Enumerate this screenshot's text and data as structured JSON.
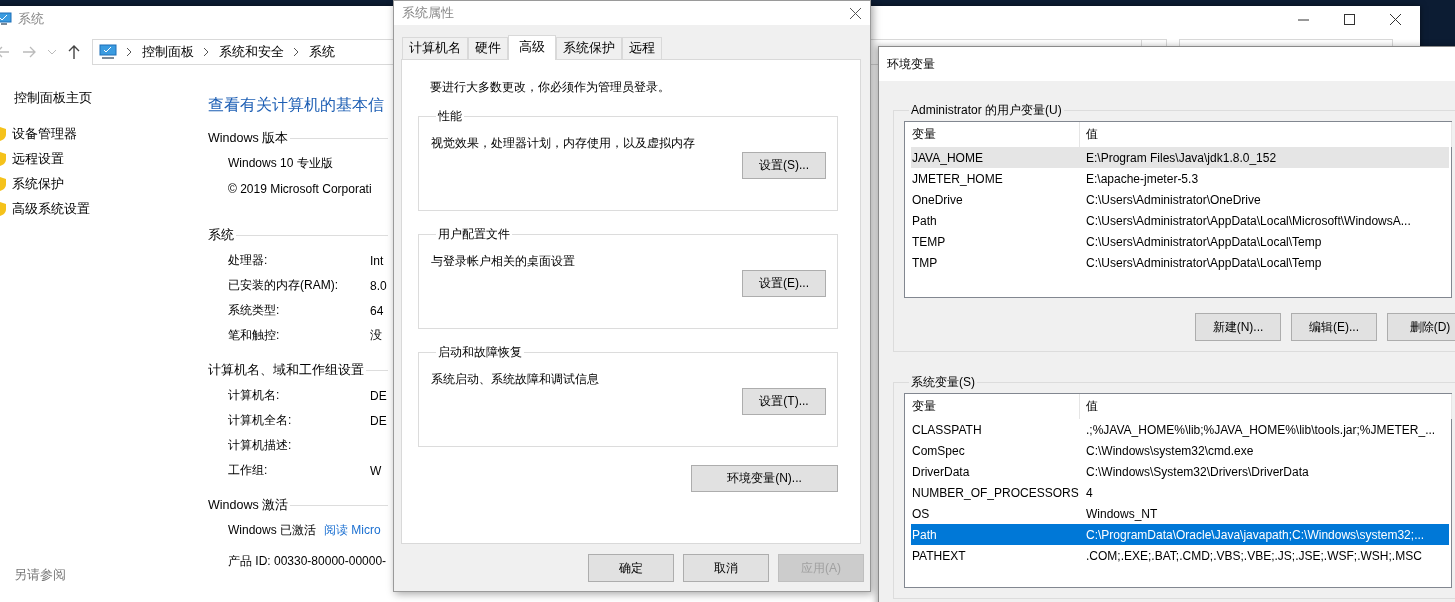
{
  "system_window": {
    "title": "系统",
    "breadcrumbs": [
      "控制面板",
      "系统和安全",
      "系统"
    ],
    "sidebar": {
      "home": "控制面板主页",
      "links": [
        "设备管理器",
        "远程设置",
        "系统保护",
        "高级系统设置"
      ],
      "see_also": "另请参阅"
    },
    "heading": "查看有关计算机的基本信",
    "sections": [
      {
        "title": "Windows 版本",
        "items": [
          {
            "kind": "text",
            "text": "Windows 10 专业版"
          },
          {
            "kind": "text",
            "text": "© 2019 Microsoft Corporati"
          }
        ]
      },
      {
        "title": "系统",
        "items": [
          {
            "kind": "field",
            "label": "处理器:",
            "value": "Int"
          },
          {
            "kind": "field",
            "label": "已安装的内存(RAM):",
            "value": "8.0"
          },
          {
            "kind": "field",
            "label": "系统类型:",
            "value": "64"
          },
          {
            "kind": "field",
            "label": "笔和触控:",
            "value": "没"
          }
        ]
      },
      {
        "title": "计算机名、域和工作组设置",
        "items": [
          {
            "kind": "field",
            "label": "计算机名:",
            "value": "DE"
          },
          {
            "kind": "field",
            "label": "计算机全名:",
            "value": "DE"
          },
          {
            "kind": "field",
            "label": "计算机描述:"
          },
          {
            "kind": "field",
            "label": "工作组:",
            "value": "W"
          }
        ]
      },
      {
        "title": "Windows 激活",
        "items": [
          {
            "kind": "status",
            "text": "Windows 已激活",
            "link": "阅读 Micro"
          },
          {
            "kind": "text",
            "text": "产品 ID: 00330-80000-00000-"
          }
        ]
      }
    ]
  },
  "properties_dialog": {
    "title": "系统属性",
    "tabs": [
      {
        "label": "计算机名",
        "selected": false
      },
      {
        "label": "硬件",
        "selected": false
      },
      {
        "label": "高级",
        "selected": true
      },
      {
        "label": "系统保护",
        "selected": false
      },
      {
        "label": "远程",
        "selected": false
      }
    ],
    "notice": "要进行大多数更改，你必须作为管理员登录。",
    "groups": [
      {
        "title": "性能",
        "description": "视觉效果，处理器计划，内存使用，以及虚拟内存",
        "button": "设置(S)..."
      },
      {
        "title": "用户配置文件",
        "description": "与登录帐户相关的桌面设置",
        "button": "设置(E)..."
      },
      {
        "title": "启动和故障恢复",
        "description": "系统启动、系统故障和调试信息",
        "button": "设置(T)..."
      }
    ],
    "env_button": "环境变量(N)...",
    "buttons": [
      {
        "label": "确定",
        "disabled": false
      },
      {
        "label": "取消",
        "disabled": false
      },
      {
        "label": "应用(A)",
        "disabled": true
      }
    ]
  },
  "env_window": {
    "title": "环境变量",
    "lists": [
      {
        "title": "Administrator 的用户变量(U)",
        "focused": false,
        "columns": [
          "变量",
          "值"
        ],
        "rows": [
          {
            "name": "JAVA_HOME",
            "value": "E:\\Program Files\\Java\\jdk1.8.0_152",
            "selected": true
          },
          {
            "name": "JMETER_HOME",
            "value": "E:\\apache-jmeter-5.3",
            "selected": false
          },
          {
            "name": "OneDrive",
            "value": "C:\\Users\\Administrator\\OneDrive",
            "selected": false
          },
          {
            "name": "Path",
            "value": "C:\\Users\\Administrator\\AppData\\Local\\Microsoft\\WindowsA...",
            "selected": false
          },
          {
            "name": "TEMP",
            "value": "C:\\Users\\Administrator\\AppData\\Local\\Temp",
            "selected": false
          },
          {
            "name": "TMP",
            "value": "C:\\Users\\Administrator\\AppData\\Local\\Temp",
            "selected": false
          }
        ],
        "buttons": [
          "新建(N)...",
          "编辑(E)...",
          "删除(D)"
        ]
      },
      {
        "title": "系统变量(S)",
        "focused": true,
        "columns": [
          "变量",
          "值"
        ],
        "rows": [
          {
            "name": "CLASSPATH",
            "value": ".;%JAVA_HOME%\\lib;%JAVA_HOME%\\lib\\tools.jar;%JMETER_...",
            "selected": false
          },
          {
            "name": "ComSpec",
            "value": "C:\\Windows\\system32\\cmd.exe",
            "selected": false
          },
          {
            "name": "DriverData",
            "value": "C:\\Windows\\System32\\Drivers\\DriverData",
            "selected": false
          },
          {
            "name": "NUMBER_OF_PROCESSORS",
            "value": "4",
            "selected": false
          },
          {
            "name": "OS",
            "value": "Windows_NT",
            "selected": false
          },
          {
            "name": "Path",
            "value": "C:\\ProgramData\\Oracle\\Java\\javapath;C:\\Windows\\system32;...",
            "selected": true
          },
          {
            "name": "PATHEXT",
            "value": ".COM;.EXE;.BAT;.CMD;.VBS;.VBE;.JS;.JSE;.WSF;.WSH;.MSC",
            "selected": false
          }
        ]
      }
    ]
  }
}
